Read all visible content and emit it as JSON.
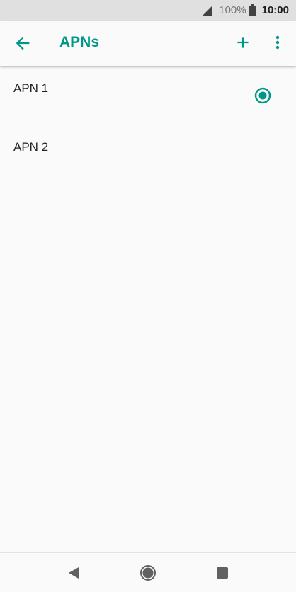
{
  "status_bar": {
    "battery_percent": "100%",
    "time": "10:00",
    "icons": [
      "signal-icon",
      "battery-icon"
    ]
  },
  "app_bar": {
    "title": "APNs",
    "icons": [
      "back-arrow-icon",
      "plus-icon",
      "more-vert-icon"
    ]
  },
  "apn_list": [
    {
      "label": "APN 1",
      "selected": true
    },
    {
      "label": "APN 2",
      "selected": false
    }
  ],
  "nav_bar": {
    "icons": [
      "back-triangle-icon",
      "home-circle-icon",
      "recents-square-icon"
    ]
  },
  "colors": {
    "accent": "#009688",
    "status_bar_bg": "#e0e0e0",
    "background": "#fafafa",
    "text": "#212121",
    "nav_icon": "#616161"
  }
}
